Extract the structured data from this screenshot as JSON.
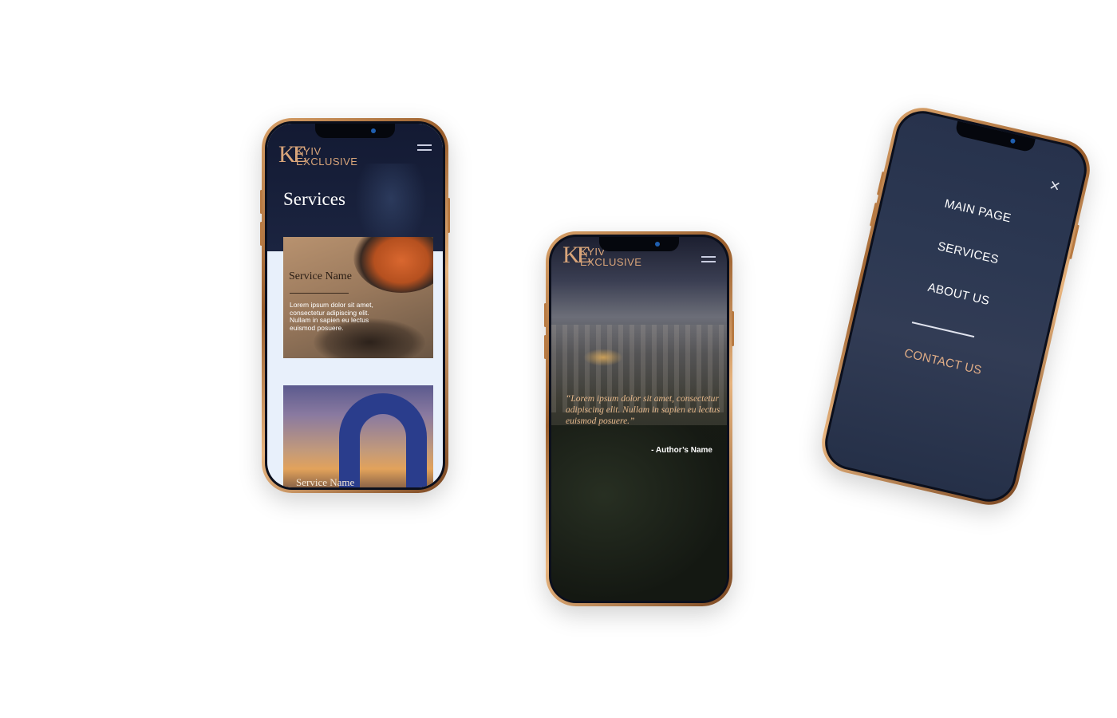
{
  "brand": {
    "logo_mark": "KE",
    "logo_line1": "KYIV",
    "logo_line2": "EXCLUSIVE",
    "accent_color": "#d9a57a"
  },
  "services_screen": {
    "title": "Services",
    "menu_icon": "hamburger-icon",
    "cards": [
      {
        "name": "Service Name",
        "description": "Lorem ipsum dolor sit amet, consectetur adipiscing elit. Nullam in sapien eu lectus euismod posuere."
      },
      {
        "name": "Service Name"
      }
    ]
  },
  "home_screen": {
    "menu_icon": "hamburger-icon",
    "quote": "“Lorem ipsum dolor sit amet, consectetur adipiscing elit. Nullam in sapien eu lectus euismod posuere.”",
    "author": "- Author’s Name"
  },
  "menu_screen": {
    "close_icon": "close-icon",
    "close_glyph": "×",
    "items": [
      "MAIN PAGE",
      "SERVICES",
      "ABOUT US"
    ],
    "contact": "CONTACT US"
  }
}
